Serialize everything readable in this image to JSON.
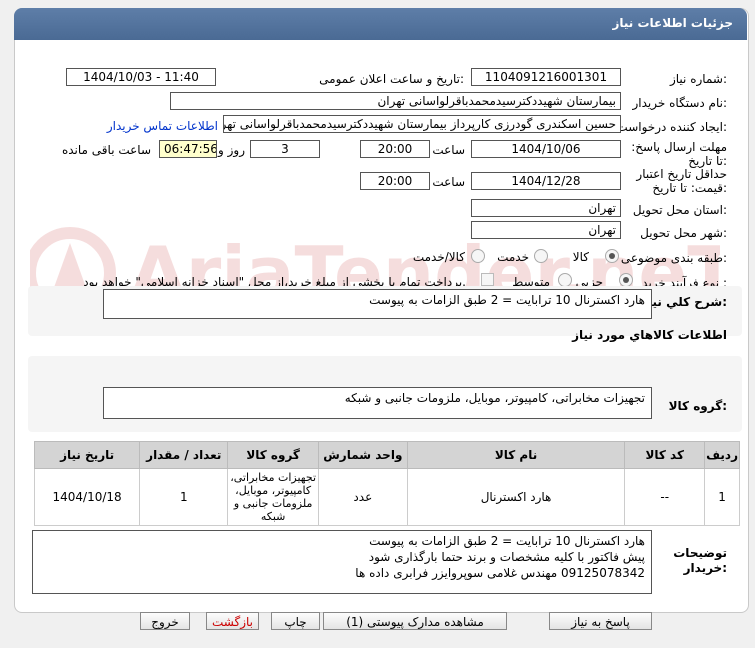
{
  "header": {
    "title": "جزئیات اطلاعات نیاز"
  },
  "form": {
    "need_number_label": "شماره نیاز:",
    "need_number": "1104091216001301",
    "announce_label": "تاریخ و ساعت اعلان عمومی:",
    "announce_value": "1404/10/03 - 11:40",
    "buyer_org_label": "نام دستگاه خریدار:",
    "buyer_org": "بیمارستان شهیددکترسیدمحمدباقرلواسانی تهران",
    "creator_label": "ایجاد کننده درخواست:",
    "creator": "حسین اسکندری گودرزی کارپرداز بیمارستان شهیددکترسیدمحمدباقرلواسانی تهران",
    "contact_link": "اطلاعات تماس خریدار",
    "deadline_label": "مهلت ارسال پاسخ: تا تاریخ:",
    "deadline_date": "1404/10/06",
    "time_label": "ساعت",
    "deadline_time": "20:00",
    "days": "3",
    "days_label": "روز و",
    "remaining": "06:47:56",
    "remaining_label": "ساعت باقی مانده",
    "validity_label": "حداقل تاریخ اعتبار قیمت: تا تاریخ:",
    "validity_date": "1404/12/28",
    "validity_time": "20:00",
    "province_label": "استان محل تحویل:",
    "province": "تهران",
    "city_label": "شهر محل تحویل:",
    "city": "تهران",
    "category_label": "طبقه بندی موضوعی:",
    "category_options": [
      "کالا",
      "خدمت",
      "کالا/خدمت"
    ],
    "process_label": "نوع فرآیند خرید :",
    "process_options": [
      "جزیی",
      "متوسط"
    ],
    "payment_note": "پرداخت تمام یا بخشی از مبلغ خرید،از محل \"اسناد خزانه اسلامی\" خواهد بود."
  },
  "summary": {
    "label": "شرح کلي نياز:",
    "value": "هارد اکسترنال 10 ترابایت = 2 طبق الزامات به پیوست"
  },
  "goods": {
    "section_title": "اطلاعات کالاهاي مورد نياز",
    "group_label": "گروه کالا:",
    "group_value": "تجهیزات مخابراتی، کامپیوتر، موبایل، ملزومات جانبی و شبکه"
  },
  "table": {
    "headers": [
      "ردیف",
      "کد کالا",
      "نام کالا",
      "واحد شمارش",
      "گروه کالا",
      "تعداد / مقدار",
      "تاریخ نیاز"
    ],
    "rows": [
      {
        "row": "1",
        "code": "--",
        "name": "هارد اکسترنال",
        "unit": "عدد",
        "group": "تجهیزات مخابراتی، کامپیوتر، موبایل، ملزومات جانبی و شبکه",
        "qty": "1",
        "date": "1404/10/18"
      }
    ]
  },
  "buyer_notes": {
    "label": "توضیحات خریدار:",
    "lines": [
      "هارد اکسترنال 10 ترابایت = 2 طبق الزامات به پیوست",
      "پیش فاکتور با کلیه مشخصات و برند حتما بارگذاری شود",
      "09125078342 مهندس غلامی سوپروایزر فرابری داده ها"
    ]
  },
  "buttons": {
    "respond": "پاسخ به نیاز",
    "attachments": "مشاهده مدارک پیوستی (1)",
    "print": "چاپ",
    "back": "بازگشت",
    "exit": "خروج"
  },
  "watermark": "AriaTender.neT",
  "colors": {
    "header": "#4f6f9a",
    "link": "#0033cc",
    "highlight": "#ffffcc"
  }
}
